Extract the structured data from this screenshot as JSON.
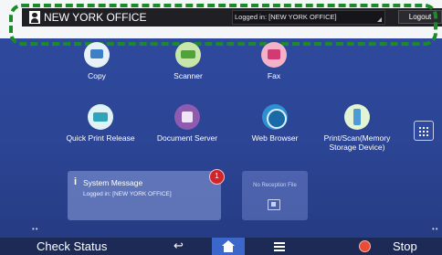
{
  "header": {
    "office_name": "NEW YORK OFFICE",
    "logged_in": "Logged in: [NEW YORK OFFICE]",
    "logout_label": "Logout"
  },
  "apps": [
    {
      "label": "Copy",
      "icon": "copy-icon"
    },
    {
      "label": "Scanner",
      "icon": "scanner-icon"
    },
    {
      "label": "Fax",
      "icon": "fax-icon"
    },
    {
      "label": "Quick Print Release",
      "icon": "quick-print-release-icon"
    },
    {
      "label": "Document Server",
      "icon": "document-server-icon"
    },
    {
      "label": "Web Browser",
      "icon": "web-browser-icon"
    },
    {
      "label": "Print/Scan(Memory Storage Device)",
      "icon": "usb-storage-icon"
    }
  ],
  "system_message": {
    "title": "System Message",
    "body": "Logged in: [NEW YORK OFFICE]",
    "badge_count": "1"
  },
  "fax_widget": {
    "label": "No Reception File"
  },
  "bottom": {
    "check_status": "Check Status",
    "stop": "Stop"
  }
}
